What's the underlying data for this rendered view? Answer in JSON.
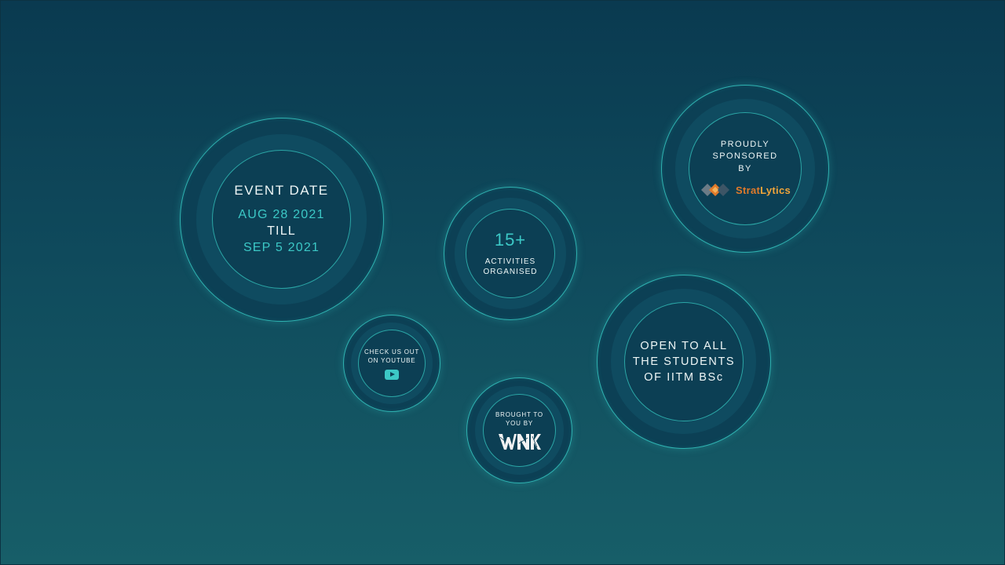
{
  "event": {
    "title": "EVENT DATE",
    "start": "AUG 28 2021",
    "till": "TILL",
    "end": "SEP 5 2021"
  },
  "activities": {
    "count": "15+",
    "label_line1": "ACTIVITIES",
    "label_line2": "ORGANISED"
  },
  "sponsor": {
    "line1": "PROUDLY",
    "line2": "SPONSORED",
    "line3": "BY",
    "logo_part1": "Strat",
    "logo_part2": "Lytics"
  },
  "youtube": {
    "line1": "CHECK US OUT",
    "line2": "ON YOUTUBE",
    "icon": "youtube-play-icon"
  },
  "organizer": {
    "line1": "BROUGHT TO",
    "line2": "YOU BY",
    "logo_text": "WNK"
  },
  "eligibility": {
    "line1": "OPEN TO ALL",
    "line2": "THE STUDENTS",
    "line3": "OF IITM BSc"
  },
  "colors": {
    "background_top": "#0a3a50",
    "background_bottom": "#175e68",
    "accent_teal": "#3cc8c6",
    "logo_orange": "#e07a2a"
  }
}
